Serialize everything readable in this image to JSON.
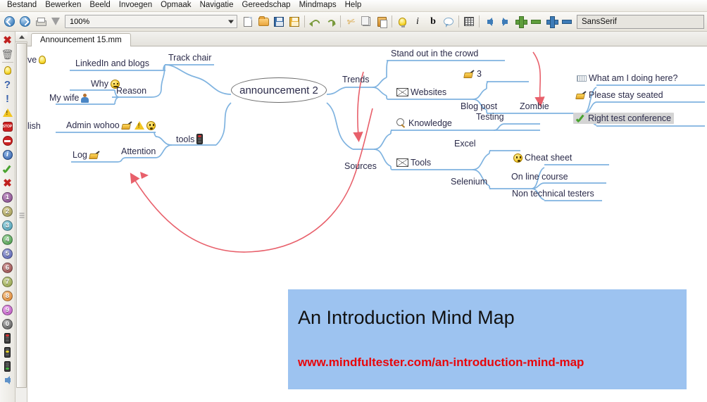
{
  "app": {
    "title": "Announcement 15.mm",
    "menu": [
      "Bestand",
      "Bewerken",
      "Beeld",
      "Invoegen",
      "Opmaak",
      "Navigatie",
      "Gereedschap",
      "Mindmaps",
      "Help"
    ]
  },
  "toolbar": {
    "zoom_value": "100%",
    "font_value": "SansSerif",
    "buttons": [
      {
        "name": "back-icon",
        "label": "Back"
      },
      {
        "name": "forward-icon",
        "label": "Forward"
      },
      {
        "name": "print-icon",
        "label": "Print"
      },
      {
        "name": "filter-icon",
        "label": "Filter"
      },
      {
        "name": "new-document-icon",
        "label": "New"
      },
      {
        "name": "open-folder-icon",
        "label": "Open"
      },
      {
        "name": "save-icon",
        "label": "Save"
      },
      {
        "name": "save-all-icon",
        "label": "Save all"
      },
      {
        "name": "undo-icon",
        "label": "Undo"
      },
      {
        "name": "redo-icon",
        "label": "Redo"
      },
      {
        "name": "cut-icon",
        "label": "Cut"
      },
      {
        "name": "copy-icon",
        "label": "Copy"
      },
      {
        "name": "paste-icon",
        "label": "Paste"
      },
      {
        "name": "idea-bulb-icon",
        "label": "New child node"
      },
      {
        "name": "italic-icon",
        "label": "Italic"
      },
      {
        "name": "bold-icon",
        "label": "Bold"
      },
      {
        "name": "note-cloud-icon",
        "label": "Note"
      },
      {
        "name": "table-icon",
        "label": "Table"
      },
      {
        "name": "arrow-left-icon",
        "label": "Move left"
      },
      {
        "name": "arrow-right-icon",
        "label": "Move right"
      },
      {
        "name": "zoom-in-green-icon",
        "label": "Zoom in"
      },
      {
        "name": "zoom-out-green-icon",
        "label": "Zoom out"
      },
      {
        "name": "zoom-in-blue-icon",
        "label": "Increase"
      },
      {
        "name": "zoom-out-blue-icon",
        "label": "Decrease"
      }
    ]
  },
  "icon_rail": [
    {
      "name": "red-cross-icon",
      "glyph": "✖",
      "color": "#c0201e"
    },
    {
      "name": "trash-icon",
      "glyph": "🗑",
      "color": "#777777"
    },
    {
      "name": "bulb-icon",
      "glyph": "bulb",
      "color": "#f2c521"
    },
    {
      "name": "question-mark-icon",
      "glyph": "?",
      "color": "#3b63ad"
    },
    {
      "name": "exclamation-mark-icon",
      "glyph": "!",
      "color": "#3b63ad"
    },
    {
      "name": "warning-triangle-icon",
      "glyph": "warn",
      "color": "#f2c521"
    },
    {
      "name": "stop-sign-icon",
      "glyph": "STOP",
      "color": "#cc2222"
    },
    {
      "name": "no-entry-icon",
      "glyph": "⛔",
      "color": "#cc2222"
    },
    {
      "name": "info-icon",
      "glyph": "i",
      "color": "#3b63ad"
    },
    {
      "name": "green-check-icon",
      "glyph": "✔",
      "color": "#49a32f"
    },
    {
      "name": "red-x-icon",
      "glyph": "✖",
      "color": "#c0201e"
    },
    {
      "name": "number-1-icon",
      "glyph": "1",
      "color": "#8a4e8f"
    },
    {
      "name": "number-2-icon",
      "glyph": "2",
      "color": "#a39a52"
    },
    {
      "name": "number-3-icon",
      "glyph": "3",
      "color": "#4fa0b5"
    },
    {
      "name": "number-4-icon",
      "glyph": "4",
      "color": "#4d9d4d"
    },
    {
      "name": "number-5-icon",
      "glyph": "5",
      "color": "#5f68b5"
    },
    {
      "name": "number-6-icon",
      "glyph": "6",
      "color": "#9c4a4a"
    },
    {
      "name": "number-7-icon",
      "glyph": "7",
      "color": "#94a24a"
    },
    {
      "name": "number-8-icon",
      "glyph": "8",
      "color": "#e08a33"
    },
    {
      "name": "number-9-icon",
      "glyph": "9",
      "color": "#bf5fc4"
    },
    {
      "name": "number-0-icon",
      "glyph": "0",
      "color": "#555555"
    },
    {
      "name": "traffic-light-red-icon",
      "glyph": "light-red",
      "color": "#d62020"
    },
    {
      "name": "traffic-light-yellow-icon",
      "glyph": "light-yellow",
      "color": "#e8d124"
    },
    {
      "name": "traffic-light-green-icon",
      "glyph": "light-green",
      "color": "#3fbb3f"
    },
    {
      "name": "blue-back-arrow-icon",
      "glyph": "arrow-left",
      "color": "#5f92c9"
    }
  ],
  "mindmap": {
    "root": "announcement 2",
    "nodes": {
      "clipped_left_top": "ve",
      "linkedin": "LinkedIn and blogs",
      "track_chair": "Track chair",
      "why": "Why",
      "reason": "Reason",
      "my_wife": "My wife",
      "clipped_left_bottom": "lish",
      "admin_wohoo": "Admin wohoo",
      "tools_left": "tools",
      "log": "Log",
      "attention": "Attention",
      "trends": "Trends",
      "stand_out": "Stand out in the crowd",
      "websites": "Websites",
      "count_3": "3",
      "blog_post": "Blog post",
      "zombie": "Zombie",
      "what_am_i": "What am I doing here?",
      "please_stay": "Please stay seated",
      "right_test_conf": "Right test conference",
      "sources": "Sources",
      "knowledge": "Knowledge",
      "testing": "Testing",
      "tools_right": "Tools",
      "excel": "Excel",
      "selenium": "Selenium",
      "cheat_sheet": "Cheat sheet",
      "online_course": "On line course",
      "non_tech": "Non technical testers"
    },
    "colors": {
      "branch": "#7fb3e0",
      "root_outline": "#6b6b6b",
      "connector": "#e8606b",
      "text": "#2b2b4a",
      "selection": "#d4d4d4"
    }
  },
  "banner": {
    "title": "An Introduction Mind Map",
    "url": "www.mindfultester.com/an-introduction-mind-map",
    "bg": "#9dc3f0",
    "url_color": "#e8070b"
  }
}
